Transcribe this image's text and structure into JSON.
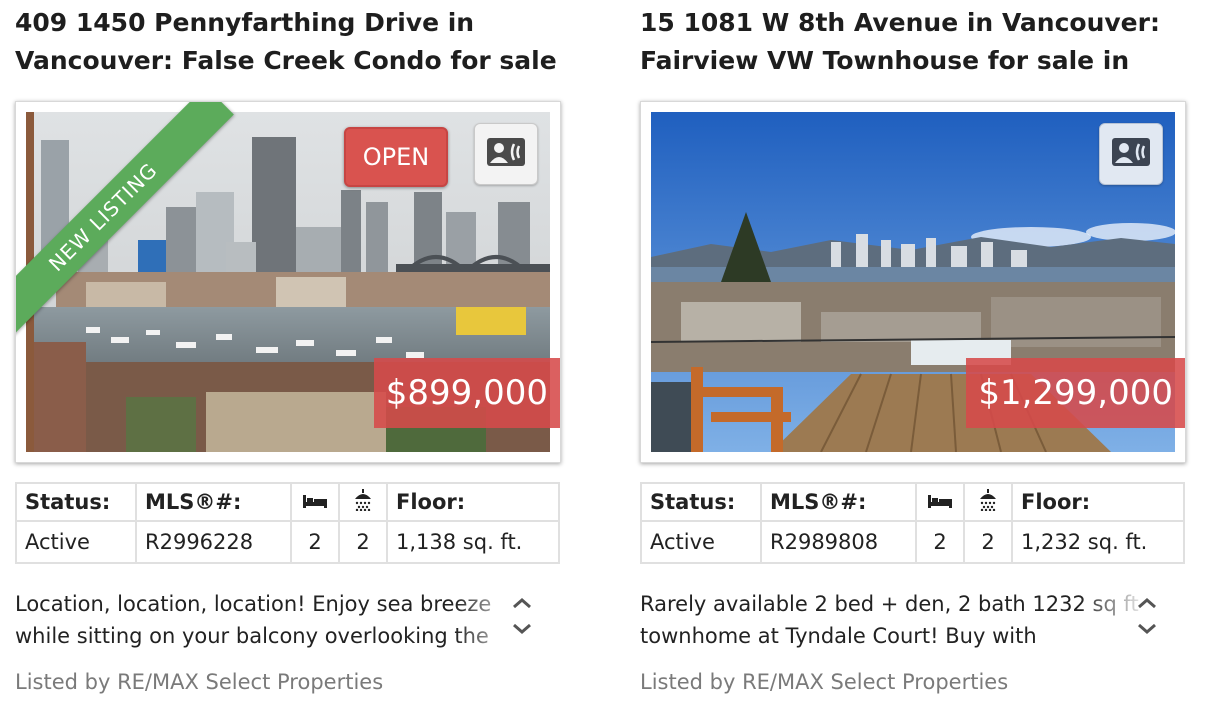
{
  "listings": [
    {
      "title_line1": "409 1450 Pennyfarthing Drive in",
      "title_line2": "Vancouver: False Creek Condo for sale",
      "ribbon": "NEW LISTING",
      "open_badge": "OPEN",
      "price": "$899,000",
      "headers": {
        "status": "Status:",
        "mls": "MLS®#:",
        "floor": "Floor:"
      },
      "status": "Active",
      "mls": "R2996228",
      "beds": "2",
      "baths": "2",
      "floor": "1,138 sq. ft.",
      "description_line1": "Location, location, location! Enjoy sea breeze",
      "description_line2": "while sitting on your balcony overlooking the",
      "listed_by": "Listed by RE/MAX Select Properties",
      "icons": {
        "bed": "bed-icon",
        "bath": "shower-icon",
        "contact": "contact-card-icon"
      }
    },
    {
      "title_line1": "15 1081 W 8th Avenue in Vancouver:",
      "title_line2": "Fairview VW Townhouse for sale in",
      "price": "$1,299,000",
      "headers": {
        "status": "Status:",
        "mls": "MLS®#:",
        "floor": "Floor:"
      },
      "status": "Active",
      "mls": "R2989808",
      "beds": "2",
      "baths": "2",
      "floor": "1,232 sq. ft.",
      "description_line1": "Rarely available 2 bed + den, 2 bath 1232 sq ft",
      "description_line2": "townhome at Tyndale Court! Buy with",
      "listed_by": "Listed by RE/MAX Select Properties",
      "icons": {
        "bed": "bed-icon",
        "bath": "shower-icon",
        "contact": "contact-card-icon"
      }
    }
  ],
  "colors": {
    "price_tag": "#d64a4a",
    "open_badge": "#d9534f",
    "ribbon": "#5cab5b",
    "listed_by_text": "#7a7a7a"
  }
}
